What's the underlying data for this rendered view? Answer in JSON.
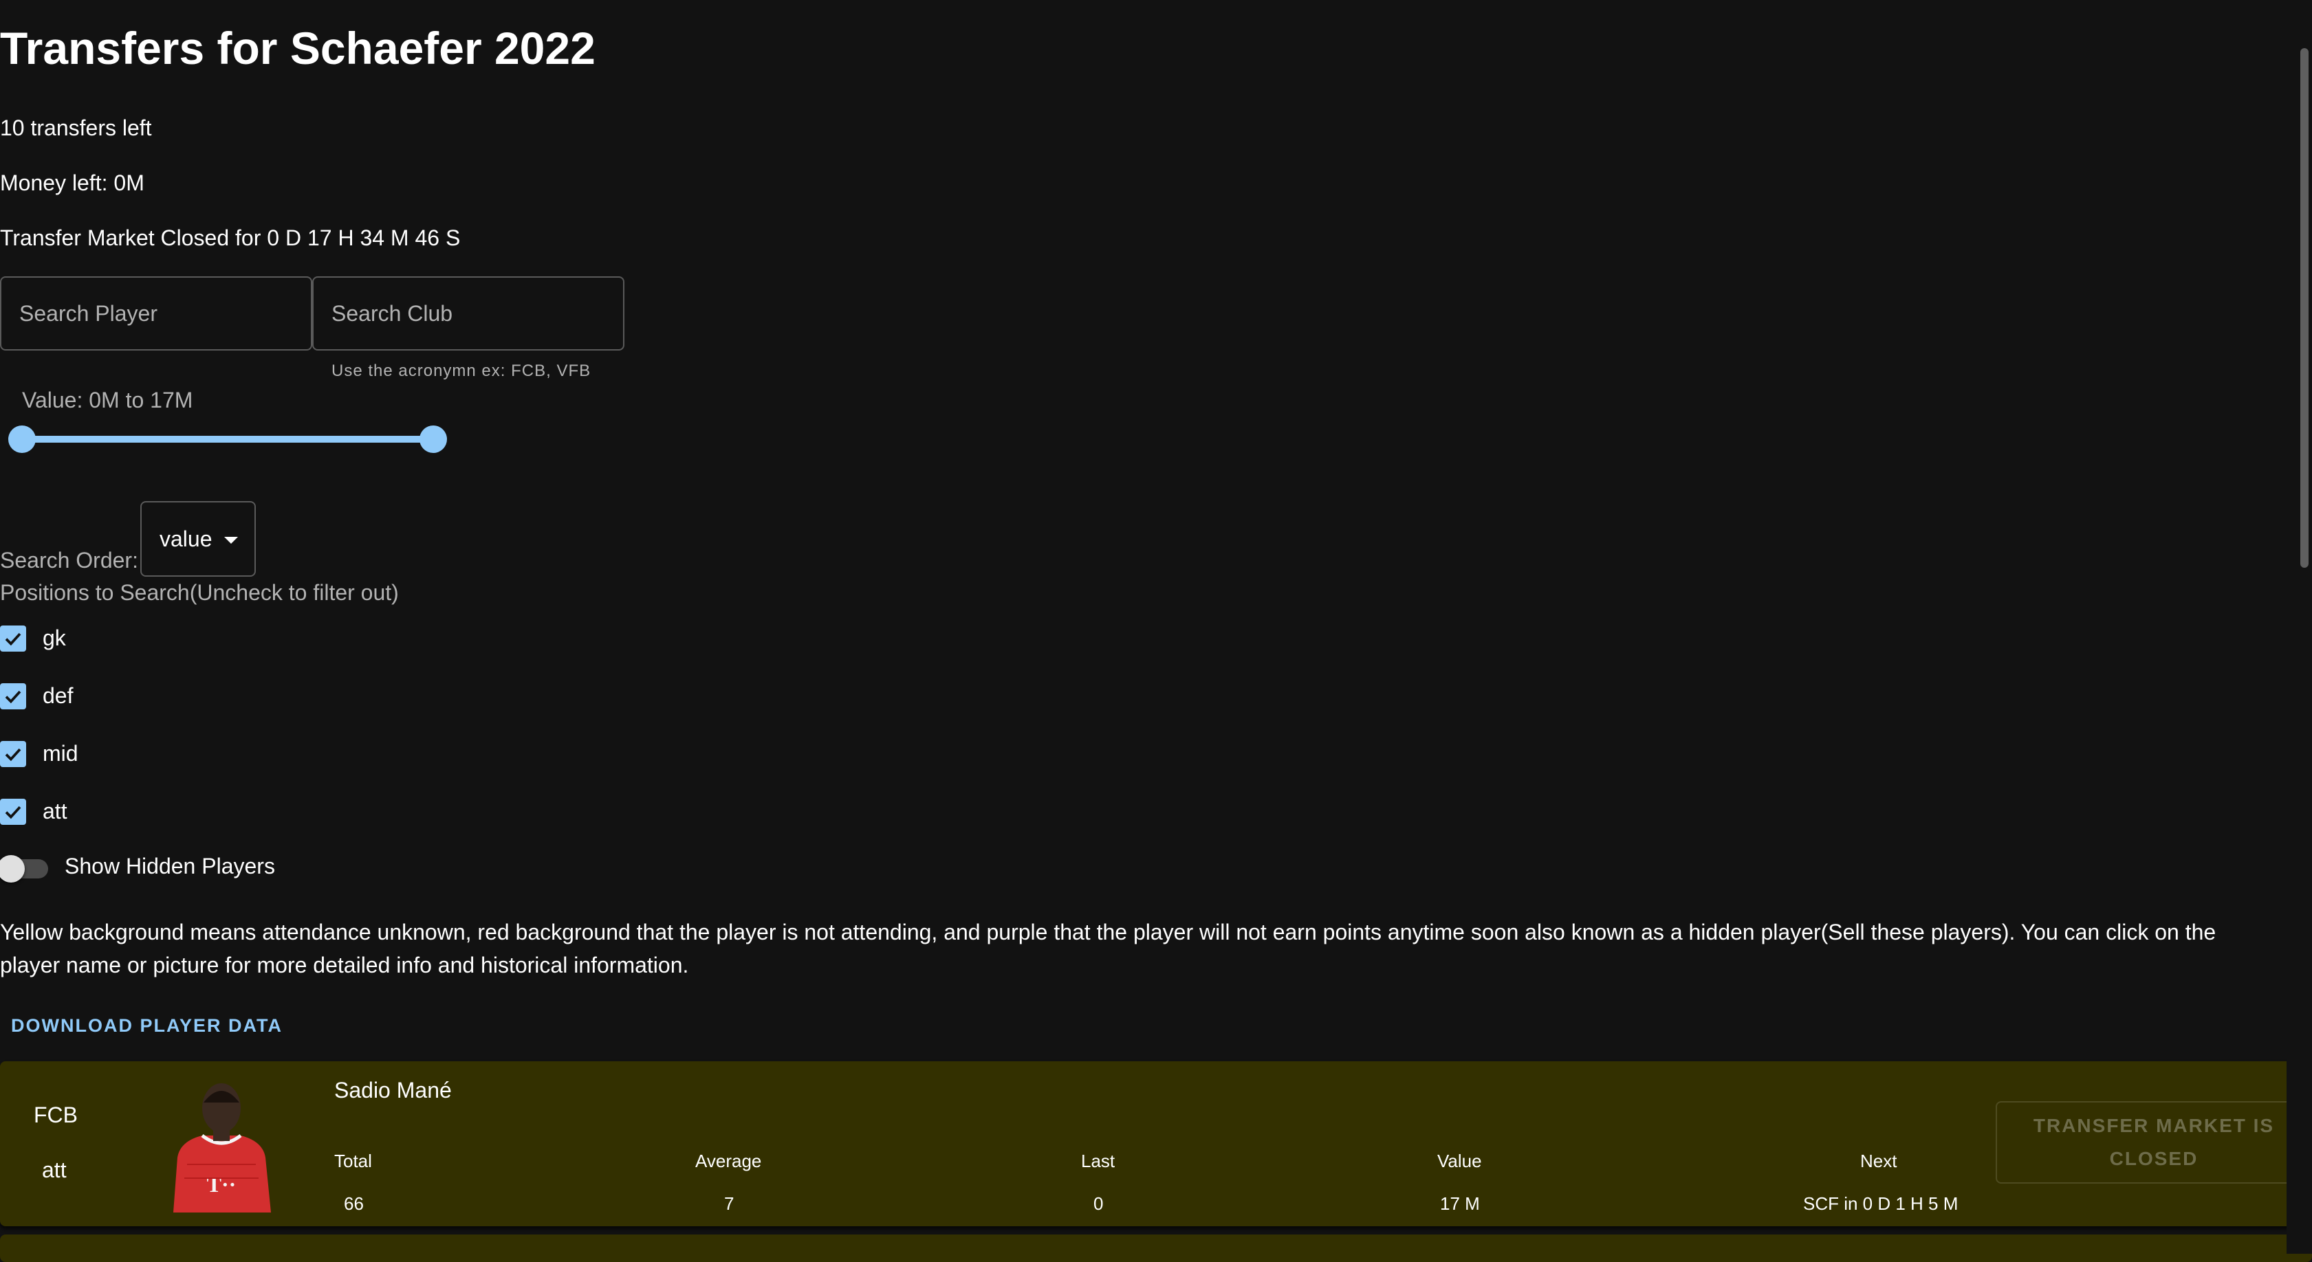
{
  "header": {
    "title": "Transfers for Schaefer 2022",
    "transfers_left": "10 transfers left",
    "money_left": "Money left: 0M",
    "market_status": "Transfer Market Closed for 0 D 17 H 34 M 46 S"
  },
  "search": {
    "player_placeholder": "Search Player",
    "club_placeholder": "Search Club",
    "club_helper": "Use the acronymn ex: FCB, VFB"
  },
  "value_filter": {
    "label": "Value: 0M to 17M",
    "min_fraction": 0.0,
    "max_fraction": 1.0
  },
  "order": {
    "label": "Search Order:",
    "selected": "value"
  },
  "positions": {
    "label": "Positions to Search(Uncheck to filter out)",
    "items": [
      {
        "label": "gk",
        "checked": true
      },
      {
        "label": "def",
        "checked": true
      },
      {
        "label": "mid",
        "checked": true
      },
      {
        "label": "att",
        "checked": true
      }
    ]
  },
  "hidden_toggle": {
    "label": "Show Hidden Players",
    "on": false
  },
  "info_text": "Yellow background means attendance unknown, red background that the player is not attending, and purple that the player will not earn points anytime soon also known as a hidden player(Sell these players). You can click on the player name or picture for more detailed info and historical information.",
  "download_label": "Download Player Data",
  "players": [
    {
      "club": "FCB",
      "position": "att",
      "name": "Sadio Mané",
      "headers": {
        "total": "Total",
        "average": "Average",
        "last": "Last",
        "value": "Value",
        "next": "Next"
      },
      "total": "66",
      "average": "7",
      "last": "0",
      "value": "17 M",
      "next": "SCF in 0 D 1 H 5 M",
      "action_label": "TRANSFER MARKET IS CLOSED",
      "background": "#333000"
    }
  ],
  "colors": {
    "background": "#121212",
    "accent": "#90caf9",
    "attendance_unknown": "#333000"
  }
}
